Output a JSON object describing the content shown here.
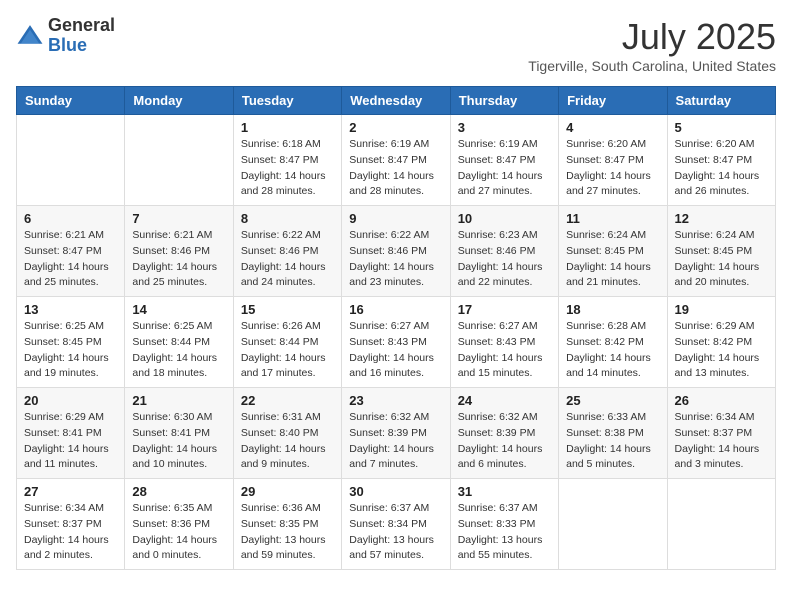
{
  "logo": {
    "general": "General",
    "blue": "Blue"
  },
  "title": "July 2025",
  "location": "Tigerville, South Carolina, United States",
  "days_of_week": [
    "Sunday",
    "Monday",
    "Tuesday",
    "Wednesday",
    "Thursday",
    "Friday",
    "Saturday"
  ],
  "weeks": [
    [
      {
        "day": "",
        "info": ""
      },
      {
        "day": "",
        "info": ""
      },
      {
        "day": "1",
        "info": "Sunrise: 6:18 AM\nSunset: 8:47 PM\nDaylight: 14 hours and 28 minutes."
      },
      {
        "day": "2",
        "info": "Sunrise: 6:19 AM\nSunset: 8:47 PM\nDaylight: 14 hours and 28 minutes."
      },
      {
        "day": "3",
        "info": "Sunrise: 6:19 AM\nSunset: 8:47 PM\nDaylight: 14 hours and 27 minutes."
      },
      {
        "day": "4",
        "info": "Sunrise: 6:20 AM\nSunset: 8:47 PM\nDaylight: 14 hours and 27 minutes."
      },
      {
        "day": "5",
        "info": "Sunrise: 6:20 AM\nSunset: 8:47 PM\nDaylight: 14 hours and 26 minutes."
      }
    ],
    [
      {
        "day": "6",
        "info": "Sunrise: 6:21 AM\nSunset: 8:47 PM\nDaylight: 14 hours and 25 minutes."
      },
      {
        "day": "7",
        "info": "Sunrise: 6:21 AM\nSunset: 8:46 PM\nDaylight: 14 hours and 25 minutes."
      },
      {
        "day": "8",
        "info": "Sunrise: 6:22 AM\nSunset: 8:46 PM\nDaylight: 14 hours and 24 minutes."
      },
      {
        "day": "9",
        "info": "Sunrise: 6:22 AM\nSunset: 8:46 PM\nDaylight: 14 hours and 23 minutes."
      },
      {
        "day": "10",
        "info": "Sunrise: 6:23 AM\nSunset: 8:46 PM\nDaylight: 14 hours and 22 minutes."
      },
      {
        "day": "11",
        "info": "Sunrise: 6:24 AM\nSunset: 8:45 PM\nDaylight: 14 hours and 21 minutes."
      },
      {
        "day": "12",
        "info": "Sunrise: 6:24 AM\nSunset: 8:45 PM\nDaylight: 14 hours and 20 minutes."
      }
    ],
    [
      {
        "day": "13",
        "info": "Sunrise: 6:25 AM\nSunset: 8:45 PM\nDaylight: 14 hours and 19 minutes."
      },
      {
        "day": "14",
        "info": "Sunrise: 6:25 AM\nSunset: 8:44 PM\nDaylight: 14 hours and 18 minutes."
      },
      {
        "day": "15",
        "info": "Sunrise: 6:26 AM\nSunset: 8:44 PM\nDaylight: 14 hours and 17 minutes."
      },
      {
        "day": "16",
        "info": "Sunrise: 6:27 AM\nSunset: 8:43 PM\nDaylight: 14 hours and 16 minutes."
      },
      {
        "day": "17",
        "info": "Sunrise: 6:27 AM\nSunset: 8:43 PM\nDaylight: 14 hours and 15 minutes."
      },
      {
        "day": "18",
        "info": "Sunrise: 6:28 AM\nSunset: 8:42 PM\nDaylight: 14 hours and 14 minutes."
      },
      {
        "day": "19",
        "info": "Sunrise: 6:29 AM\nSunset: 8:42 PM\nDaylight: 14 hours and 13 minutes."
      }
    ],
    [
      {
        "day": "20",
        "info": "Sunrise: 6:29 AM\nSunset: 8:41 PM\nDaylight: 14 hours and 11 minutes."
      },
      {
        "day": "21",
        "info": "Sunrise: 6:30 AM\nSunset: 8:41 PM\nDaylight: 14 hours and 10 minutes."
      },
      {
        "day": "22",
        "info": "Sunrise: 6:31 AM\nSunset: 8:40 PM\nDaylight: 14 hours and 9 minutes."
      },
      {
        "day": "23",
        "info": "Sunrise: 6:32 AM\nSunset: 8:39 PM\nDaylight: 14 hours and 7 minutes."
      },
      {
        "day": "24",
        "info": "Sunrise: 6:32 AM\nSunset: 8:39 PM\nDaylight: 14 hours and 6 minutes."
      },
      {
        "day": "25",
        "info": "Sunrise: 6:33 AM\nSunset: 8:38 PM\nDaylight: 14 hours and 5 minutes."
      },
      {
        "day": "26",
        "info": "Sunrise: 6:34 AM\nSunset: 8:37 PM\nDaylight: 14 hours and 3 minutes."
      }
    ],
    [
      {
        "day": "27",
        "info": "Sunrise: 6:34 AM\nSunset: 8:37 PM\nDaylight: 14 hours and 2 minutes."
      },
      {
        "day": "28",
        "info": "Sunrise: 6:35 AM\nSunset: 8:36 PM\nDaylight: 14 hours and 0 minutes."
      },
      {
        "day": "29",
        "info": "Sunrise: 6:36 AM\nSunset: 8:35 PM\nDaylight: 13 hours and 59 minutes."
      },
      {
        "day": "30",
        "info": "Sunrise: 6:37 AM\nSunset: 8:34 PM\nDaylight: 13 hours and 57 minutes."
      },
      {
        "day": "31",
        "info": "Sunrise: 6:37 AM\nSunset: 8:33 PM\nDaylight: 13 hours and 55 minutes."
      },
      {
        "day": "",
        "info": ""
      },
      {
        "day": "",
        "info": ""
      }
    ]
  ]
}
